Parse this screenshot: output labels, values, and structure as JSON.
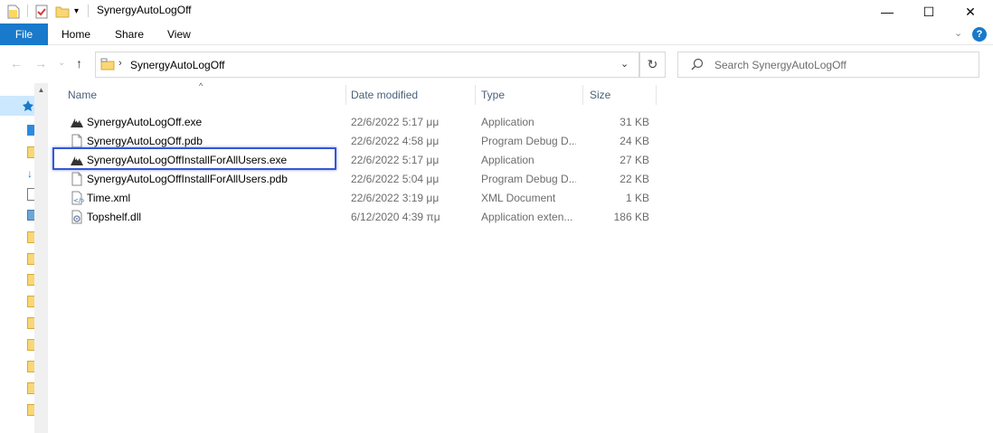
{
  "window": {
    "title": "SynergyAutoLogOff",
    "minimize_label": "—",
    "maximize_label": "☐",
    "close_label": "✕"
  },
  "ribbon": {
    "file": "File",
    "tabs": [
      "Home",
      "Share",
      "View"
    ],
    "help": "?",
    "expand": "⌄"
  },
  "nav": {
    "back": "←",
    "forward": "→",
    "recent": "⌄",
    "up": "↑"
  },
  "address": {
    "separator": "›",
    "path": "SynergyAutoLogOff",
    "dropdown": "⌄",
    "refresh": "↻"
  },
  "search": {
    "placeholder": "Search SynergyAutoLogOff"
  },
  "columns": {
    "name": "Name",
    "date": "Date modified",
    "type": "Type",
    "size": "Size",
    "sort_arrow": "^"
  },
  "files": [
    {
      "name": "SynergyAutoLogOff.exe",
      "date": "22/6/2022 5:17 μμ",
      "type": "Application",
      "size": "31 KB",
      "icon": "app-icon"
    },
    {
      "name": "SynergyAutoLogOff.pdb",
      "date": "22/6/2022 4:58 μμ",
      "type": "Program Debug D...",
      "size": "24 KB",
      "icon": "file-icon"
    },
    {
      "name": "SynergyAutoLogOffInstallForAllUsers.exe",
      "date": "22/6/2022 5:17 μμ",
      "type": "Application",
      "size": "27 KB",
      "icon": "app-icon"
    },
    {
      "name": "SynergyAutoLogOffInstallForAllUsers.pdb",
      "date": "22/6/2022 5:04 μμ",
      "type": "Program Debug D...",
      "size": "22 KB",
      "icon": "file-icon"
    },
    {
      "name": "Time.xml",
      "date": "22/6/2022 3:19 μμ",
      "type": "XML Document",
      "size": "1 KB",
      "icon": "xml-icon"
    },
    {
      "name": "Topshelf.dll",
      "date": "6/12/2020 4:39 πμ",
      "type": "Application exten...",
      "size": "186 KB",
      "icon": "dll-icon"
    }
  ],
  "colors": {
    "accent": "#1979ca",
    "highlight_border": "#3557d6",
    "selection": "#cce8ff"
  }
}
